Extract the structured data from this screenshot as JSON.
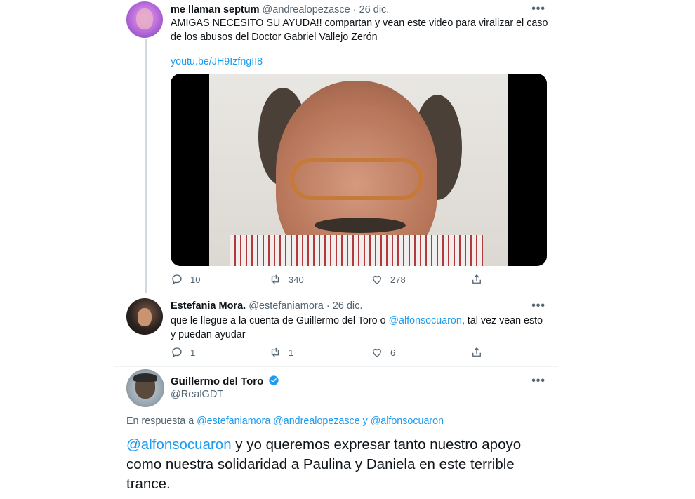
{
  "tweet1": {
    "name": "me llaman septum",
    "handle": "@andrealopezasce",
    "date": "· 26 dic.",
    "text": "AMIGAS NECESITO SU AYUDA!! compartan y vean este video para viralizar el caso de los abusos del Doctor Gabriel Vallejo Zerón",
    "link": "youtu.be/JH9IzfngII8",
    "replies": "10",
    "retweets": "340",
    "likes": "278"
  },
  "tweet2": {
    "name": "Estefania Mora.",
    "handle": "@estefaniamora",
    "date": "· 26 dic.",
    "text_before": "que le llegue a la cuenta de Guillermo del Toro o ",
    "mention": "@alfonsocuaron",
    "text_after": ", tal vez vean esto y puedan ayudar",
    "replies": "1",
    "retweets": "1",
    "likes": "6"
  },
  "tweet3": {
    "name": "Guillermo del Toro",
    "handle": "@RealGDT",
    "reply_prefix": "En respuesta a ",
    "reply_mentions": "@estefaniamora @andrealopezasce y @alfonsocuaron",
    "mention": "@alfonsocuaron",
    "text": " y yo queremos expresar tanto nuestro apoyo como nuestra solidaridad a Paulina y Daniela en este terrible trance."
  },
  "more_label": "•••",
  "colors": {
    "link": "#1d9bf0",
    "muted": "#536471",
    "verified": "#1d9bf0"
  }
}
